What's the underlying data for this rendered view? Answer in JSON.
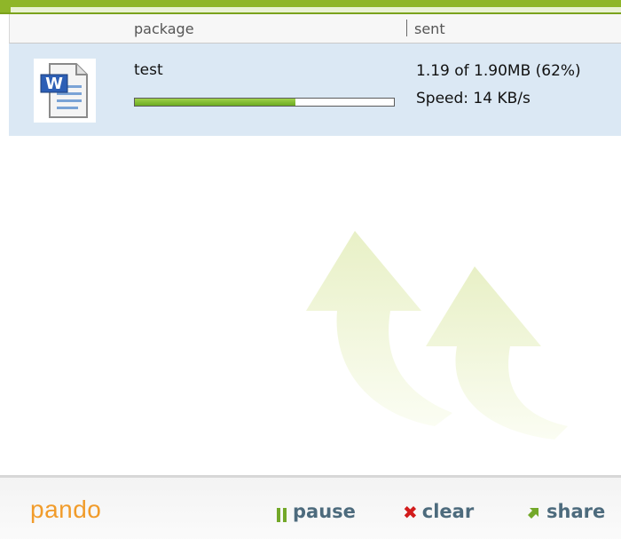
{
  "header": {
    "package_label": "package",
    "sent_label": "sent"
  },
  "row": {
    "name": "test",
    "sent": "1.19 of 1.90MB (62%)",
    "speed": "Speed: 14 KB/s",
    "progress_fraction": 0.62,
    "file_icon": "word-document-icon"
  },
  "footer": {
    "logo": "pando",
    "pause_label": "pause",
    "clear_label": "clear",
    "share_label": "share"
  },
  "colors": {
    "accent_green": "#8fb629",
    "logo_orange": "#f19c2b",
    "row_bg": "#dbe8f4"
  }
}
